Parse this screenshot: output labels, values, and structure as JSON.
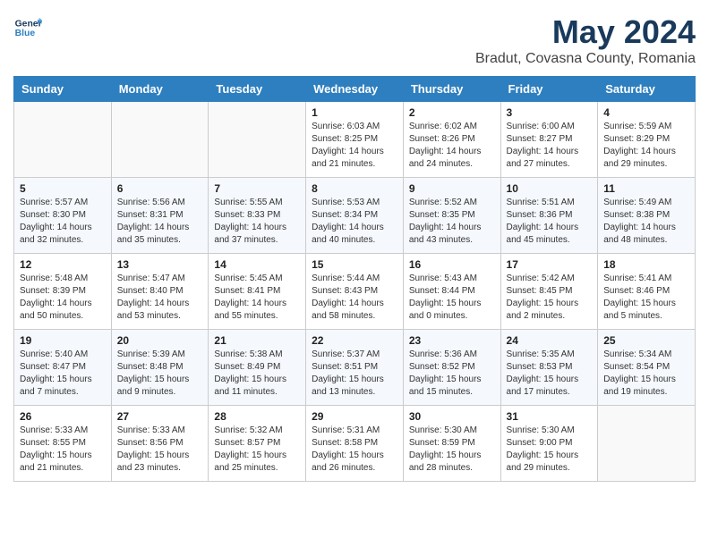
{
  "header": {
    "logo_line1": "General",
    "logo_line2": "Blue",
    "month": "May 2024",
    "location": "Bradut, Covasna County, Romania"
  },
  "days_of_week": [
    "Sunday",
    "Monday",
    "Tuesday",
    "Wednesday",
    "Thursday",
    "Friday",
    "Saturday"
  ],
  "weeks": [
    [
      {
        "day": "",
        "info": ""
      },
      {
        "day": "",
        "info": ""
      },
      {
        "day": "",
        "info": ""
      },
      {
        "day": "1",
        "info": "Sunrise: 6:03 AM\nSunset: 8:25 PM\nDaylight: 14 hours\nand 21 minutes."
      },
      {
        "day": "2",
        "info": "Sunrise: 6:02 AM\nSunset: 8:26 PM\nDaylight: 14 hours\nand 24 minutes."
      },
      {
        "day": "3",
        "info": "Sunrise: 6:00 AM\nSunset: 8:27 PM\nDaylight: 14 hours\nand 27 minutes."
      },
      {
        "day": "4",
        "info": "Sunrise: 5:59 AM\nSunset: 8:29 PM\nDaylight: 14 hours\nand 29 minutes."
      }
    ],
    [
      {
        "day": "5",
        "info": "Sunrise: 5:57 AM\nSunset: 8:30 PM\nDaylight: 14 hours\nand 32 minutes."
      },
      {
        "day": "6",
        "info": "Sunrise: 5:56 AM\nSunset: 8:31 PM\nDaylight: 14 hours\nand 35 minutes."
      },
      {
        "day": "7",
        "info": "Sunrise: 5:55 AM\nSunset: 8:33 PM\nDaylight: 14 hours\nand 37 minutes."
      },
      {
        "day": "8",
        "info": "Sunrise: 5:53 AM\nSunset: 8:34 PM\nDaylight: 14 hours\nand 40 minutes."
      },
      {
        "day": "9",
        "info": "Sunrise: 5:52 AM\nSunset: 8:35 PM\nDaylight: 14 hours\nand 43 minutes."
      },
      {
        "day": "10",
        "info": "Sunrise: 5:51 AM\nSunset: 8:36 PM\nDaylight: 14 hours\nand 45 minutes."
      },
      {
        "day": "11",
        "info": "Sunrise: 5:49 AM\nSunset: 8:38 PM\nDaylight: 14 hours\nand 48 minutes."
      }
    ],
    [
      {
        "day": "12",
        "info": "Sunrise: 5:48 AM\nSunset: 8:39 PM\nDaylight: 14 hours\nand 50 minutes."
      },
      {
        "day": "13",
        "info": "Sunrise: 5:47 AM\nSunset: 8:40 PM\nDaylight: 14 hours\nand 53 minutes."
      },
      {
        "day": "14",
        "info": "Sunrise: 5:45 AM\nSunset: 8:41 PM\nDaylight: 14 hours\nand 55 minutes."
      },
      {
        "day": "15",
        "info": "Sunrise: 5:44 AM\nSunset: 8:43 PM\nDaylight: 14 hours\nand 58 minutes."
      },
      {
        "day": "16",
        "info": "Sunrise: 5:43 AM\nSunset: 8:44 PM\nDaylight: 15 hours\nand 0 minutes."
      },
      {
        "day": "17",
        "info": "Sunrise: 5:42 AM\nSunset: 8:45 PM\nDaylight: 15 hours\nand 2 minutes."
      },
      {
        "day": "18",
        "info": "Sunrise: 5:41 AM\nSunset: 8:46 PM\nDaylight: 15 hours\nand 5 minutes."
      }
    ],
    [
      {
        "day": "19",
        "info": "Sunrise: 5:40 AM\nSunset: 8:47 PM\nDaylight: 15 hours\nand 7 minutes."
      },
      {
        "day": "20",
        "info": "Sunrise: 5:39 AM\nSunset: 8:48 PM\nDaylight: 15 hours\nand 9 minutes."
      },
      {
        "day": "21",
        "info": "Sunrise: 5:38 AM\nSunset: 8:49 PM\nDaylight: 15 hours\nand 11 minutes."
      },
      {
        "day": "22",
        "info": "Sunrise: 5:37 AM\nSunset: 8:51 PM\nDaylight: 15 hours\nand 13 minutes."
      },
      {
        "day": "23",
        "info": "Sunrise: 5:36 AM\nSunset: 8:52 PM\nDaylight: 15 hours\nand 15 minutes."
      },
      {
        "day": "24",
        "info": "Sunrise: 5:35 AM\nSunset: 8:53 PM\nDaylight: 15 hours\nand 17 minutes."
      },
      {
        "day": "25",
        "info": "Sunrise: 5:34 AM\nSunset: 8:54 PM\nDaylight: 15 hours\nand 19 minutes."
      }
    ],
    [
      {
        "day": "26",
        "info": "Sunrise: 5:33 AM\nSunset: 8:55 PM\nDaylight: 15 hours\nand 21 minutes."
      },
      {
        "day": "27",
        "info": "Sunrise: 5:33 AM\nSunset: 8:56 PM\nDaylight: 15 hours\nand 23 minutes."
      },
      {
        "day": "28",
        "info": "Sunrise: 5:32 AM\nSunset: 8:57 PM\nDaylight: 15 hours\nand 25 minutes."
      },
      {
        "day": "29",
        "info": "Sunrise: 5:31 AM\nSunset: 8:58 PM\nDaylight: 15 hours\nand 26 minutes."
      },
      {
        "day": "30",
        "info": "Sunrise: 5:30 AM\nSunset: 8:59 PM\nDaylight: 15 hours\nand 28 minutes."
      },
      {
        "day": "31",
        "info": "Sunrise: 5:30 AM\nSunset: 9:00 PM\nDaylight: 15 hours\nand 29 minutes."
      },
      {
        "day": "",
        "info": ""
      }
    ]
  ]
}
